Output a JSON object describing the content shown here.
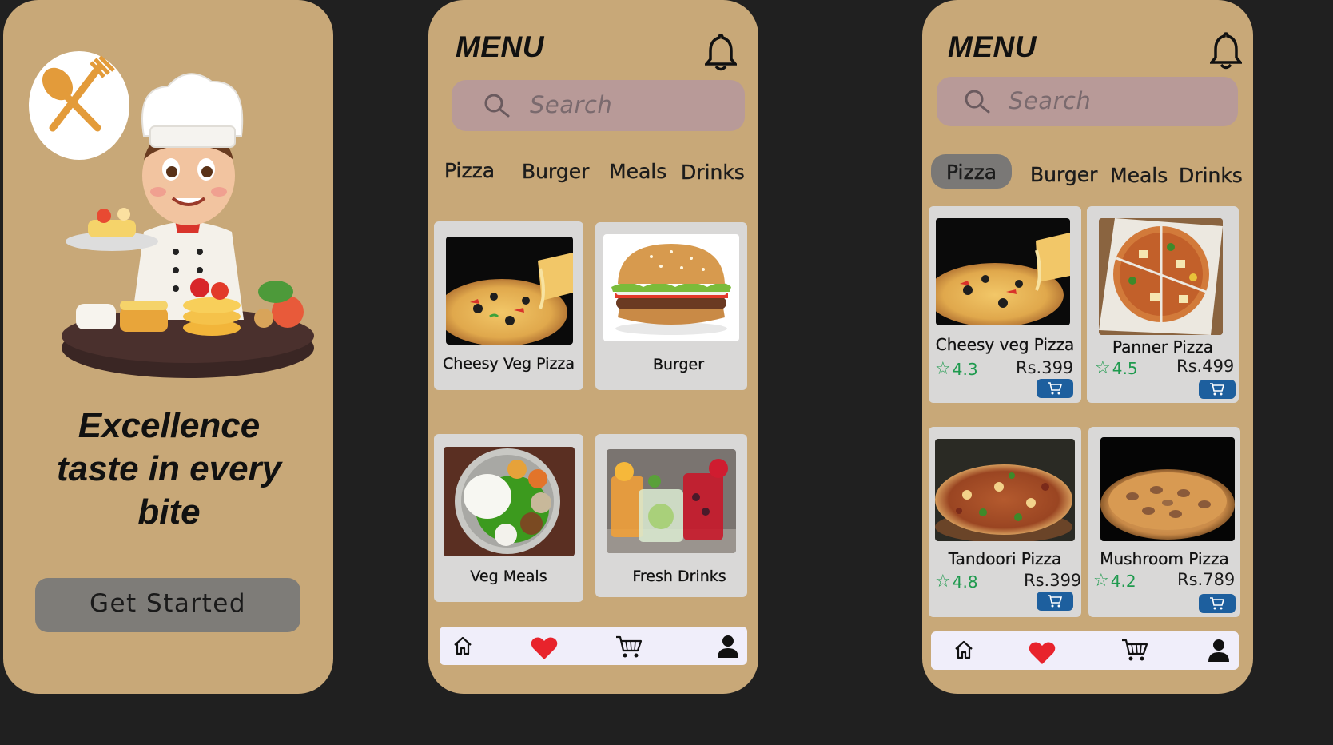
{
  "colors": {
    "screen_background": "#c8a878",
    "page_background": "#202020",
    "search_background": "#b89a98",
    "button_background": "#7e7c78",
    "card_background": "#d9d8d7",
    "rating_green": "#1f9a4e",
    "cart_button_blue": "#1d5f9e",
    "heart_red": "#e8232c",
    "bottom_nav_background": "#f0eefa"
  },
  "onboarding": {
    "logo_icon": "spoon-fork-icon",
    "illustration": "chef-serving-food-illustration",
    "headline": "Excellence taste in every bite",
    "cta_label": "Get Started"
  },
  "menu": {
    "title": "MENU",
    "bell_icon": "bell-icon",
    "search_placeholder": "Search",
    "categories": [
      "Pizza",
      "Burger",
      "Meals",
      "Drinks"
    ],
    "items": [
      {
        "label": "Cheesy Veg Pizza",
        "image": "cheesy-pizza-photo"
      },
      {
        "label": "Burger",
        "image": "burger-photo"
      },
      {
        "label": "Veg Meals",
        "image": "veg-thali-photo"
      },
      {
        "label": "Fresh Drinks",
        "image": "fresh-drinks-photo"
      }
    ],
    "bottom_nav": [
      "home-icon",
      "heart-icon",
      "cart-icon",
      "user-icon"
    ]
  },
  "pizza_menu": {
    "title": "MENU",
    "search_placeholder": "Search",
    "categories": [
      "Pizza",
      "Burger",
      "Meals",
      "Drinks"
    ],
    "active_category": "Pizza",
    "products": [
      {
        "name": "Cheesy veg Pizza",
        "rating": "4.3",
        "price": "Rs.399",
        "image": "cheesy-pizza-photo"
      },
      {
        "name": "Panner Pizza",
        "rating": "4.5",
        "price": "Rs.499",
        "image": "paneer-pizza-photo"
      },
      {
        "name": "Tandoori Pizza",
        "rating": "4.8",
        "price": "Rs.399",
        "image": "tandoori-pizza-photo"
      },
      {
        "name": "Mushroom Pizza",
        "rating": "4.2",
        "price": "Rs.789",
        "image": "mushroom-pizza-photo"
      }
    ],
    "bottom_nav": [
      "home-icon",
      "heart-icon",
      "cart-icon",
      "user-icon"
    ]
  }
}
